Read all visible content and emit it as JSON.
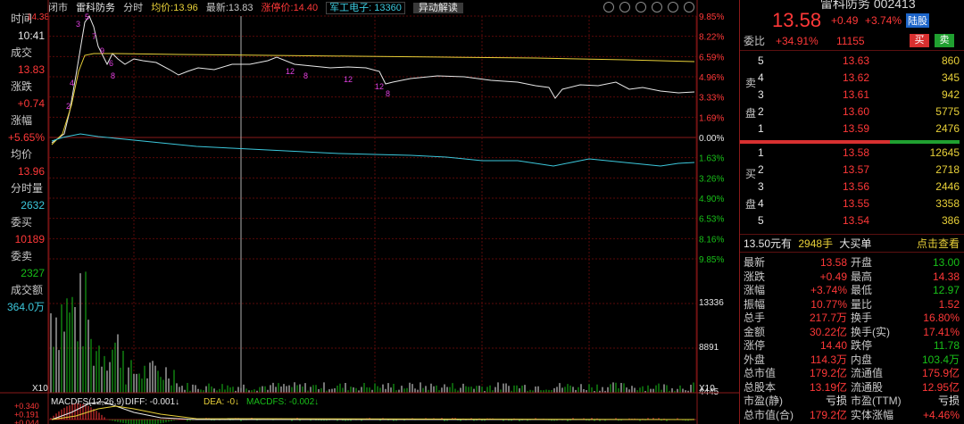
{
  "stock": {
    "name": "雷科防务",
    "title": "雷科防务 002413",
    "mode": "分时",
    "avg_label": "均价:",
    "avg_value": "13.96",
    "latest_label": "最新:",
    "latest_value": "13.83",
    "limit_label": "涨停价:",
    "limit_value": "14.40",
    "sector": "军工电子: 13360",
    "unusual_btn": "异动解读",
    "close_tab": "闭市"
  },
  "left_info": [
    {
      "label": "时间",
      "value": "10:41",
      "color": "white"
    },
    {
      "label": "成交",
      "value": "13.83",
      "color": "red"
    },
    {
      "label": "涨跌",
      "value": "+0.74",
      "color": "red"
    },
    {
      "label": "涨幅",
      "value": "+5.65%",
      "color": "red"
    },
    {
      "label": "均价",
      "value": "13.96",
      "color": "red"
    },
    {
      "label": "分时量",
      "value": "2632",
      "color": "cyan"
    },
    {
      "label": "委买",
      "value": "10189",
      "color": "red"
    },
    {
      "label": "委卖",
      "value": "2327",
      "color": "green"
    },
    {
      "label": "成交额",
      "value": "364.0万",
      "color": "cyan"
    }
  ],
  "price_axis": {
    "top_price": "14.38",
    "right_ticks": [
      "9.85%",
      "8.22%",
      "6.59%",
      "4.96%",
      "3.33%",
      "1.69%",
      "0.00%",
      "1.63%",
      "3.26%",
      "4.90%",
      "6.53%",
      "8.16%",
      "9.85%"
    ],
    "volume_ticks": [
      "13336",
      "8891",
      "4445"
    ],
    "x10_left": "X10",
    "x10_right": "X10"
  },
  "macd": {
    "header": "MACDFS(12,26,9)",
    "diff": "DIFF: -0.001↓",
    "dea": "DEA: -0↓",
    "macdfs": "MACDFS: -0.002↓",
    "ticks": [
      "+0.340",
      "+0.191",
      "+0.044"
    ]
  },
  "right_panel": {
    "price": "13.58",
    "change": "+0.49",
    "pct": "+3.74%",
    "badge": "陆股",
    "weibi_label": "委比",
    "weibi_value": "+34.91%",
    "weicha_value": "11155",
    "sell_btn": "买",
    "buy_btn": "卖",
    "sell_side_chars": [
      "卖",
      "盘"
    ],
    "buy_side_chars": [
      "买",
      "盘"
    ],
    "asks": [
      {
        "level": "5",
        "price": "13.63",
        "vol": "860"
      },
      {
        "level": "4",
        "price": "13.62",
        "vol": "345"
      },
      {
        "level": "3",
        "price": "13.61",
        "vol": "942"
      },
      {
        "level": "2",
        "price": "13.60",
        "vol": "5775"
      },
      {
        "level": "1",
        "price": "13.59",
        "vol": "2476"
      }
    ],
    "bids": [
      {
        "level": "1",
        "price": "13.58",
        "vol": "12645"
      },
      {
        "level": "2",
        "price": "13.57",
        "vol": "2718"
      },
      {
        "level": "3",
        "price": "13.56",
        "vol": "2446"
      },
      {
        "level": "4",
        "price": "13.55",
        "vol": "3358"
      },
      {
        "level": "5",
        "price": "13.54",
        "vol": "386"
      }
    ],
    "bigorder": {
      "price": "13.50元有",
      "vol": "2948手",
      "label": "大买单",
      "link": "点击查看"
    },
    "stats": [
      {
        "k1": "最新",
        "v1": "13.58",
        "c1": "red",
        "k2": "开盘",
        "v2": "13.00",
        "c2": "green"
      },
      {
        "k1": "涨跌",
        "v1": "+0.49",
        "c1": "red",
        "k2": "最高",
        "v2": "14.38",
        "c2": "red"
      },
      {
        "k1": "涨幅",
        "v1": "+3.74%",
        "c1": "red",
        "k2": "最低",
        "v2": "12.97",
        "c2": "green"
      },
      {
        "k1": "振幅",
        "v1": "10.77%",
        "c1": "red",
        "k2": "量比",
        "v2": "1.52",
        "c2": "red"
      },
      {
        "k1": "总手",
        "v1": "217.7万",
        "c1": "red",
        "k2": "换手",
        "v2": "16.80%",
        "c2": "red"
      },
      {
        "k1": "金额",
        "v1": "30.22亿",
        "c1": "red",
        "k2": "换手(实)",
        "v2": "17.41%",
        "c2": "red"
      },
      {
        "k1": "涨停",
        "v1": "14.40",
        "c1": "red",
        "k2": "跌停",
        "v2": "11.78",
        "c2": "green"
      },
      {
        "k1": "外盘",
        "v1": "114.3万",
        "c1": "red",
        "k2": "内盘",
        "v2": "103.4万",
        "c2": "green"
      },
      {
        "k1": "总市值",
        "v1": "179.2亿",
        "c1": "red",
        "k2": "流通值",
        "v2": "175.9亿",
        "c2": "red"
      },
      {
        "k1": "总股本",
        "v1": "13.19亿",
        "c1": "red",
        "k2": "流通股",
        "v2": "12.95亿",
        "c2": "red"
      },
      {
        "k1": "市盈(静)",
        "v1": "亏损",
        "c1": "white",
        "k2": "市盈(TTM)",
        "v2": "亏损",
        "c2": "white"
      },
      {
        "k1": "总市值(合)",
        "v1": "179.2亿",
        "c1": "red",
        "k2": "实体涨幅",
        "v2": "+4.46%",
        "c2": "red"
      }
    ]
  },
  "colors": {
    "up": "#ff3838",
    "down": "#18c018",
    "grid": "#5a0a0a",
    "price_line": "#e8e8e8",
    "avg_line": "#e8d038",
    "index_line": "#3cc8dc",
    "magenta": "#e040e0"
  }
}
